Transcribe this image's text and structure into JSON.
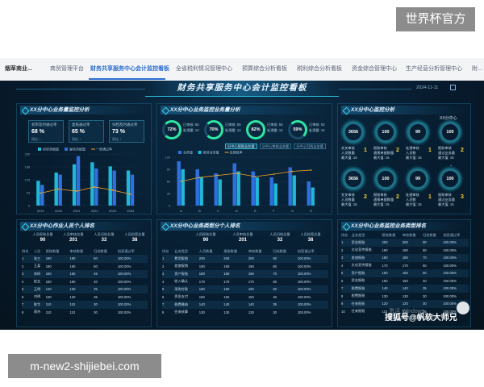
{
  "watermarks": {
    "top": "世界杯官方",
    "bottom": "m-new2-shijiebei.com"
  },
  "tabs": [
    {
      "label": "烟草商业..."
    },
    {
      "label": "商贸管理平台"
    },
    {
      "label": "财务共享服务中心会计监控看板"
    },
    {
      "label": "全省税利情况管理中心"
    },
    {
      "label": "预算综合分析看板"
    },
    {
      "label": "税利综合分析看板"
    },
    {
      "label": "资金综合管理中心"
    },
    {
      "label": "生产经营分析管理中心"
    },
    {
      "label": "附..."
    }
  ],
  "dashboard": {
    "title": "财务共享服务中心会计监控看板",
    "date": "2024-11-11"
  },
  "panel_left_top": {
    "title": "XX分中心业务量监控分析",
    "kpis": [
      {
        "label": "初审及时通过率",
        "pct": "68 %",
        "sub": "同比 ↑"
      },
      {
        "label": "复核通过率",
        "pct": "65 %",
        "sub": "同比 ↑"
      },
      {
        "label": "归档及时通过率",
        "pct": "73 %",
        "sub": "同比 ↑"
      }
    ],
    "legend": [
      "初审单据量",
      "复核单据量",
      "归档单据量",
      "一审通过率"
    ]
  },
  "panel_mid_top": {
    "title": "XX分中心业务监控业务量分析",
    "rings": [
      {
        "value": "72%",
        "info": [
          "已审核: 55",
          "处理量: 12"
        ]
      },
      {
        "value": "70%",
        "info": [
          "已审核: 55",
          "处理量: 12"
        ]
      },
      {
        "value": "82%",
        "info": [
          "已审核: 55",
          "处理量: 12"
        ]
      },
      {
        "value": "59%",
        "info": [
          "已审核: 55",
          "处理量: 12"
        ]
      }
    ],
    "buttons": [
      "分中心报账业务量",
      "分中心审核业务量",
      "分中心归档业务量"
    ],
    "legend": [
      "业务量",
      "审核业务量",
      "处理效率"
    ]
  },
  "panel_right_top": {
    "title": "XX分中心监控分析",
    "center_label": "XX分中心",
    "rings_row1": [
      {
        "value": "3656",
        "lines": [
          "交叉审核",
          "人员数量",
          "最大值: 15"
        ],
        "num": "1"
      },
      {
        "value": "100",
        "lines": [
          "报账审核",
          "通报单据数量",
          "最大值: 15"
        ],
        "num": "2"
      },
      {
        "value": "99",
        "lines": [
          "处理审核",
          "人员数",
          "最大值: 15"
        ],
        "num": "1"
      },
      {
        "value": "100",
        "lines": [
          "报账审核",
          "通过业务量",
          "最大值: 15"
        ],
        "num": "2"
      }
    ],
    "rings_row2": [
      {
        "value": "3656",
        "lines": [
          "交叉审核",
          "人员数量",
          "最大值: 15"
        ],
        "num": "2"
      },
      {
        "value": "100",
        "lines": [
          "报账审核",
          "通报单据数量",
          "最大值: 15"
        ],
        "num": "2"
      },
      {
        "value": "99",
        "lines": [
          "处理审核",
          "人员数",
          "最大值: 15"
        ],
        "num": "1"
      },
      {
        "value": "100",
        "lines": [
          "报账审核",
          "通过业务量",
          "最大值: 15"
        ],
        "num": "3"
      }
    ]
  },
  "panel_left_bottom": {
    "title": "XX分中心作业人员个人排名",
    "stats": [
      {
        "label": "人员报账总量",
        "value": "90"
      },
      {
        "label": "人员审核总量",
        "value": "201"
      },
      {
        "label": "人员归档总量",
        "value": "32"
      },
      {
        "label": "人员档案总量",
        "value": "38"
      }
    ],
    "headers": [
      "排名",
      "人员",
      "报账数量",
      "审核数量",
      "归档数量",
      "档案通过率"
    ],
    "rows": [
      [
        "1",
        "张三",
        "190",
        "190",
        "50",
        "100.00%"
      ],
      [
        "2",
        "王某",
        "190",
        "190",
        "50",
        "100.00%"
      ],
      [
        "3",
        "李四",
        "160",
        "160",
        "45",
        "100.00%"
      ],
      [
        "4",
        "赵五",
        "150",
        "150",
        "40",
        "100.00%"
      ],
      [
        "5",
        "王明",
        "140",
        "130",
        "35",
        "100.00%"
      ],
      [
        "6",
        "刘明",
        "130",
        "120",
        "35",
        "100.00%"
      ],
      [
        "7",
        "陈华",
        "110",
        "110",
        "30",
        "100.00%"
      ],
      [
        "8",
        "周杰",
        "110",
        "110",
        "30",
        "100.00%"
      ]
    ]
  },
  "panel_mid_bottom": {
    "title": "XX分中心业务类型分个人排名",
    "stats": [
      {
        "label": "人员报账总量",
        "value": "90"
      },
      {
        "label": "人员审核总量",
        "value": "201"
      },
      {
        "label": "人员归档总量",
        "value": "32"
      },
      {
        "label": "人员档案总量",
        "value": "38"
      }
    ],
    "headers": [
      "排名",
      "业务类型",
      "人员数量",
      "报账数量",
      "审核数量",
      "归档数量",
      "档案通过率"
    ],
    "rows": [
      [
        "1",
        "费用报销",
        "200",
        "200",
        "200",
        "90",
        "100.00%"
      ],
      [
        "2",
        "差旅报销",
        "190",
        "190",
        "190",
        "80",
        "100.00%"
      ],
      [
        "3",
        "资产报账",
        "180",
        "180",
        "180",
        "70",
        "100.00%"
      ],
      [
        "4",
        "收入确认",
        "170",
        "170",
        "170",
        "60",
        "100.00%"
      ],
      [
        "5",
        "采购付款",
        "160",
        "160",
        "160",
        "50",
        "100.00%"
      ],
      [
        "6",
        "资金支付",
        "150",
        "150",
        "150",
        "40",
        "100.00%"
      ],
      [
        "7",
        "税费缴纳",
        "140",
        "140",
        "140",
        "35",
        "100.00%"
      ],
      [
        "8",
        "往来核算",
        "130",
        "130",
        "130",
        "30",
        "100.00%"
      ]
    ]
  },
  "panel_right_bottom": {
    "title": "XX分中心业务监控业务类型排名",
    "headers": [
      "排名",
      "业务类型",
      "报账数量",
      "审核数量",
      "归档数量",
      "档案通过率"
    ],
    "rows": [
      [
        "1",
        "资金报账",
        "200",
        "200",
        "90",
        "100.00%"
      ],
      [
        "2",
        "文化宣传报账",
        "190",
        "190",
        "80",
        "100.00%"
      ],
      [
        "3",
        "差旅报账",
        "180",
        "180",
        "70",
        "100.00%"
      ],
      [
        "4",
        "文化宣传报账",
        "170",
        "170",
        "60",
        "100.00%"
      ],
      [
        "5",
        "资产报账",
        "160",
        "160",
        "50",
        "100.00%"
      ],
      [
        "6",
        "资金报账",
        "150",
        "150",
        "40",
        "100.00%"
      ],
      [
        "7",
        "税费报账",
        "140",
        "140",
        "35",
        "100.00%"
      ],
      [
        "8",
        "税费报账",
        "130",
        "130",
        "30",
        "100.00%"
      ],
      [
        "9",
        "往来报账",
        "120",
        "120",
        "30",
        "100.00%"
      ],
      [
        "10",
        "往来报账",
        "110",
        "110",
        "25",
        "100.00%"
      ]
    ]
  },
  "overlay": {
    "windows_activate": "激活 Windows",
    "windows_activate_sub": "转到\"设置\"以激活 Windows。",
    "sohu": "搜狐号@帆软大师兄"
  },
  "colors": {
    "bar_cyan": "#1fb8d8",
    "bar_blue": "#2f6fe0",
    "line_orange": "#f5a623",
    "ring_green": "#2ee6a0",
    "accent": "#3fd0e6"
  },
  "chart_data": [
    {
      "type": "bar",
      "categories": [
        "2019",
        "2020",
        "2021",
        "2022",
        "2023",
        "2024"
      ],
      "series": [
        {
          "name": "初审单据量",
          "values": [
            120,
            160,
            200,
            210,
            190,
            170
          ]
        },
        {
          "name": "复核单据量",
          "values": [
            100,
            150,
            240,
            180,
            170,
            150
          ]
        },
        {
          "name": "一审通过率",
          "values": [
            60,
            80,
            70,
            90,
            75,
            55
          ]
        }
      ],
      "ylim": [
        0,
        250
      ]
    },
    {
      "type": "bar",
      "categories": [
        "A",
        "B",
        "C",
        "D",
        "E",
        "F",
        "G",
        "H"
      ],
      "series": [
        {
          "name": "业务量",
          "values": [
            110,
            90,
            80,
            105,
            85,
            70,
            95,
            60
          ]
        },
        {
          "name": "审核业务量",
          "values": [
            90,
            70,
            65,
            85,
            70,
            55,
            75,
            45
          ]
        },
        {
          "name": "处理效率",
          "values": [
            60,
            70,
            75,
            80,
            72,
            78,
            85,
            88
          ]
        }
      ],
      "ylim": [
        0,
        120
      ]
    }
  ]
}
